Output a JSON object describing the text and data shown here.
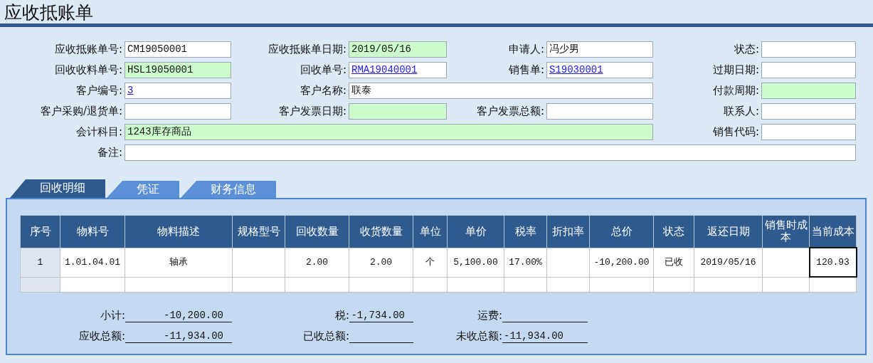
{
  "title": "应收抵账单",
  "form_rows": [
    [
      {
        "label": "应收抵账单号:",
        "value": "CM19050001",
        "kind": "text",
        "highlighted": false
      },
      {
        "label": "应收抵账单日期:",
        "value": "2019/05/16",
        "kind": "text",
        "highlighted": true
      },
      {
        "label": "申请人:",
        "value": "冯少男",
        "kind": "text",
        "highlighted": false
      },
      {
        "label": "状态:",
        "kind": "text",
        "highlighted": false
      }
    ],
    [
      {
        "label": "回收收料单号:",
        "value": "HSL19050001",
        "kind": "text",
        "highlighted": true
      },
      {
        "label": "回收单号:",
        "value": "RMA19040001",
        "kind": "link",
        "highlighted": false
      },
      {
        "label": "销售单:",
        "value": "S19030001",
        "kind": "link",
        "highlighted": false
      },
      {
        "label": "过期日期:",
        "kind": "text",
        "highlighted": false
      }
    ],
    [
      {
        "label": "客户编号:",
        "value": "3",
        "kind": "link",
        "highlighted": false
      },
      {
        "label": "客户名称:",
        "value": "联泰",
        "kind": "wide",
        "highlighted": false
      },
      {
        "label": "付款周期:",
        "kind": "text",
        "highlighted": true
      }
    ],
    [
      {
        "label": "客户采购/退货单:",
        "kind": "text",
        "highlighted": false
      },
      {
        "label": "客户发票日期:",
        "kind": "text",
        "highlighted": true
      },
      {
        "label": "客户发票总额:",
        "kind": "text",
        "highlighted": false
      },
      {
        "label": "联系人:",
        "kind": "text",
        "highlighted": false
      }
    ],
    [
      {
        "label": "会计科目:",
        "value": "1243库存商品",
        "kind": "extrawide",
        "highlighted": true
      },
      {
        "label": "销售代码:",
        "kind": "text",
        "highlighted": false
      }
    ],
    [
      {
        "label": "备注:",
        "kind": "full",
        "highlighted": false
      }
    ]
  ],
  "tabs": [
    {
      "label": "回收明细",
      "selected": true
    },
    {
      "label": "凭证",
      "selected": false
    },
    {
      "label": "财务信息",
      "selected": false
    }
  ],
  "table": {
    "columns": [
      "序号",
      "物料号",
      "物料描述",
      "规格型号",
      "回收数量",
      "收货数量",
      "单位",
      "单价",
      "税率",
      "折扣率",
      "总价",
      "状态",
      "返还日期",
      "销售时成本",
      "当前成本"
    ],
    "rows": [
      {
        "cells": [
          {
            "text": "1",
            "focused": false
          },
          {
            "text": "1.01.04.01",
            "focused": false
          },
          {
            "text": "轴承",
            "focused": false
          },
          {
            "focused": false
          },
          {
            "text": "2.00",
            "focused": false
          },
          {
            "text": "2.00",
            "focused": false
          },
          {
            "text": "个",
            "focused": false
          },
          {
            "text": "5,100.00",
            "focused": false
          },
          {
            "text": "17.00%",
            "focused": false
          },
          {
            "focused": false
          },
          {
            "text": "-10,200.00",
            "focused": false
          },
          {
            "text": "已收",
            "focused": false
          },
          {
            "text": "2019/05/16",
            "focused": false
          },
          {
            "focused": false
          },
          {
            "text": "120.93",
            "focused": true
          }
        ]
      }
    ]
  },
  "totals": [
    [
      {
        "label": "小计:",
        "value": "-10,200.00"
      },
      {
        "label": "税:",
        "value": "-1,734.00"
      },
      {
        "label": "运费:"
      }
    ],
    [
      {
        "label": "应收总额:",
        "value": "-11,934.00"
      },
      {
        "label": "已收总额:"
      },
      {
        "label": "未收总额:",
        "value": "-11,934.00"
      }
    ]
  ]
}
